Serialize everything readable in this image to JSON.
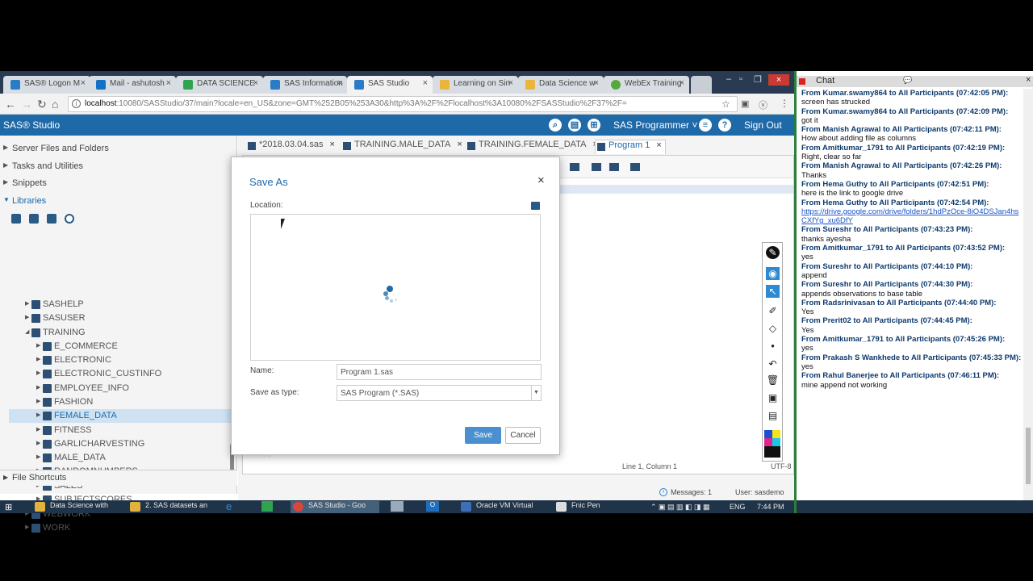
{
  "browser": {
    "tabs": [
      {
        "label": "SAS® Logon M",
        "x": "close"
      },
      {
        "label": "Mail - ashutosh",
        "x": "close"
      },
      {
        "label": "DATA SCIENCE",
        "x": "close"
      },
      {
        "label": "SAS Information",
        "x": "close"
      },
      {
        "label": "SAS Studio",
        "x": "close"
      },
      {
        "label": "Learning on Sin",
        "x": "close"
      },
      {
        "label": "Data Science w",
        "x": "close"
      },
      {
        "label": "WebEx Training",
        "x": "close"
      }
    ],
    "url_host": "localhost",
    "url_rest": ":10080/SASStudio/37/main?locale=en_US&zone=GMT%252B05%253A30&http%3A%2F%2Flocalhost%3A10080%2FSASStudio%2F37%2F=",
    "close_glyph": "×"
  },
  "sas_header": {
    "brand": "SAS® Studio",
    "perspective": "SAS Programmer ˅",
    "sign_out": "Sign Out"
  },
  "left_nav": {
    "sections": {
      "server_files": "Server Files and Folders",
      "tasks": "Tasks and Utilities",
      "snippets": "Snippets",
      "libraries": "Libraries",
      "file_shortcuts": "File Shortcuts"
    },
    "libraries": [
      {
        "label": "SASHELP"
      },
      {
        "label": "SASUSER"
      },
      {
        "label": "TRAINING"
      },
      {
        "label": "E_COMMERCE"
      },
      {
        "label": "ELECTRONIC"
      },
      {
        "label": "ELECTRONIC_CUSTINFO"
      },
      {
        "label": "EMPLOYEE_INFO"
      },
      {
        "label": "FASHION"
      },
      {
        "label": "FEMALE_DATA"
      },
      {
        "label": "FITNESS"
      },
      {
        "label": "GARLICHARVESTING"
      },
      {
        "label": "MALE_DATA"
      },
      {
        "label": "RANDOMNUMBERS"
      },
      {
        "label": "SALES"
      },
      {
        "label": "SUBJECTSCORES"
      },
      {
        "label": "WEBWORK"
      },
      {
        "label": "WORK"
      }
    ]
  },
  "editor": {
    "tabs": [
      {
        "label": "*2018.03.04.sas"
      },
      {
        "label": "TRAINING.MALE_DATA"
      },
      {
        "label": "TRAINING.FEMALE_DATA"
      },
      {
        "label": "Program 1"
      }
    ],
    "cursor_pos": "Line 1, Column 1",
    "encoding": "UTF-8",
    "messages": "Messages: 1",
    "user": "User: sasdemo"
  },
  "dialog": {
    "title": "Save As",
    "location_label": "Location:",
    "name_label": "Name:",
    "name_value": "Program 1.sas",
    "type_label": "Save as type:",
    "type_value": "SAS Program (*.SAS)",
    "save": "Save",
    "cancel": "Cancel"
  },
  "taskbar": {
    "items": [
      {
        "label": "Data Science with",
        "color": "#e3b23c"
      },
      {
        "label": "2. SAS datasets an",
        "color": "#e3b23c"
      },
      {
        "label": "SAS Studio - Goo",
        "color": "#d9463b"
      },
      {
        "label": "Oracle VM Virtual",
        "color": "#3d6fb6"
      },
      {
        "label": "Fnic Pen",
        "color": "#dddddd"
      }
    ],
    "lang": "ENG",
    "time": "7:44 PM"
  },
  "chat": {
    "title": "Chat",
    "messages": [
      {
        "from": "From Kumar.swamy864 to All Participants (07:42:05 PM):",
        "text": "screen has strucked"
      },
      {
        "from": "From Kumar.swamy864 to All Participants (07:42:09 PM):",
        "text": "got it"
      },
      {
        "from": "From Manish Agrawal to All Participants (07:42:11 PM):",
        "text": "How about adding file as columns"
      },
      {
        "from": "From Amitkumar_1791 to All Participants (07:42:19 PM):",
        "text": "Right, clear so far"
      },
      {
        "from": "From Manish Agrawal to All Participants (07:42:26 PM):",
        "text": "Thanks"
      },
      {
        "from": "From Hema Guthy to All Participants (07:42:51 PM):",
        "text": "here is the link to google drive"
      },
      {
        "from": "From Hema Guthy to All Participants (07:42:54 PM):",
        "text": "https://drive.google.com/drive/folders/1hdPzOce-8iO4DSJan4hsCXfYg_xu6DfY",
        "link": true
      },
      {
        "from": "From Sureshr to All Participants (07:43:23 PM):",
        "text": "thanks ayesha"
      },
      {
        "from": "From Amitkumar_1791 to All Participants (07:43:52 PM):",
        "text": "yes"
      },
      {
        "from": "From Sureshr to All Participants (07:44:10 PM):",
        "text": "append"
      },
      {
        "from": "From Sureshr to All Participants (07:44:30 PM):",
        "text": "appends observations to base table"
      },
      {
        "from": "From Radsrinivasan to All Participants (07:44:40 PM):",
        "text": "Yes"
      },
      {
        "from": "From Prerit02 to All Participants (07:44:45 PM):",
        "text": "Yes"
      },
      {
        "from": "From Amitkumar_1791 to All Participants (07:45:26 PM):",
        "text": "yes"
      },
      {
        "from": "From Prakash S Wankhede to All Participants (07:45:33 PM):",
        "text": "yes"
      },
      {
        "from": "From Rahul Banerjee to All Participants (07:46:11 PM):",
        "text": "mine append not working"
      }
    ]
  },
  "colors": {
    "sas_blue": "#1e69a8",
    "selection": "#cfe2f3",
    "chat_border": "#2a7f3a"
  }
}
